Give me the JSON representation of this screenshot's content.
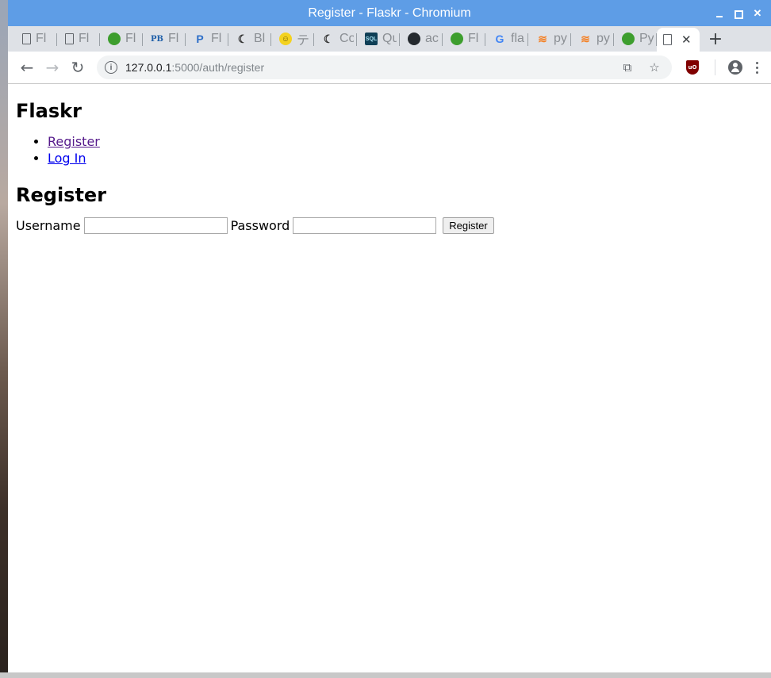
{
  "window": {
    "title": "Register - Flaskr - Chromium"
  },
  "tabs": [
    {
      "icon": "document-icon",
      "label": "Fl"
    },
    {
      "icon": "document-icon",
      "label": "Fl"
    },
    {
      "icon": "flask-icon",
      "label": "Fl"
    },
    {
      "icon": "pb-icon",
      "label": "Fl"
    },
    {
      "icon": "p-icon",
      "label": "Fl"
    },
    {
      "icon": "moon-icon",
      "label": "Bl"
    },
    {
      "icon": "smiley-icon",
      "label": "テ"
    },
    {
      "icon": "moon-icon",
      "label": "Co"
    },
    {
      "icon": "sqlite-icon",
      "label": "Qu"
    },
    {
      "icon": "github-icon",
      "label": "ac"
    },
    {
      "icon": "flask-icon",
      "label": "Fl"
    },
    {
      "icon": "google-icon",
      "label": "fla"
    },
    {
      "icon": "stackoverflow-icon",
      "label": "py"
    },
    {
      "icon": "stackoverflow-icon",
      "label": "py"
    },
    {
      "icon": "flask-icon",
      "label": "Py"
    }
  ],
  "address": {
    "host": "127.0.0.1",
    "rest": ":5000/auth/register"
  },
  "page": {
    "site_title": "Flaskr",
    "nav": {
      "register": "Register",
      "login": "Log In"
    },
    "heading": "Register",
    "form": {
      "username_label": "Username",
      "username_value": "",
      "password_label": "Password",
      "password_value": "",
      "submit_label": "Register"
    }
  }
}
